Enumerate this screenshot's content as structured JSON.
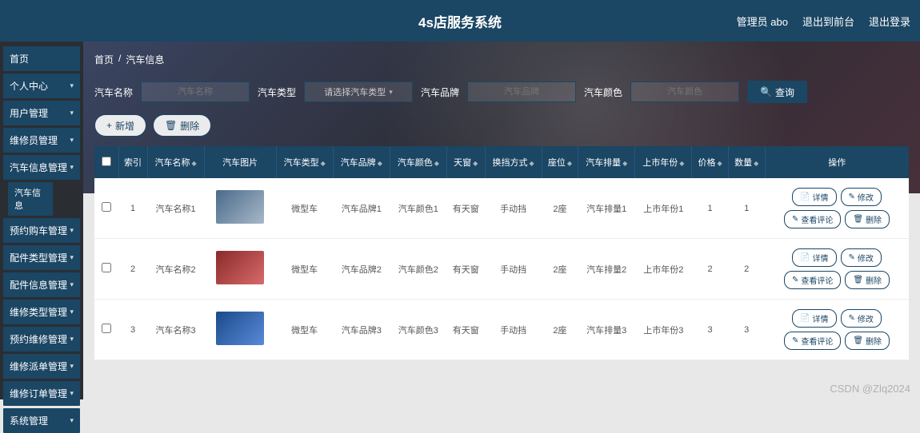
{
  "header": {
    "title": "4s店服务系统",
    "user": "管理员 abo",
    "logout_front": "退出到前台",
    "logout": "退出登录"
  },
  "sidebar": {
    "items": [
      {
        "label": "首页",
        "expand": false
      },
      {
        "label": "个人中心",
        "expand": true
      },
      {
        "label": "用户管理",
        "expand": true
      },
      {
        "label": "维修员管理",
        "expand": true
      },
      {
        "label": "汽车信息管理",
        "expand": true,
        "active": true,
        "sub": "汽车信息"
      },
      {
        "label": "预约购车管理",
        "expand": true
      },
      {
        "label": "配件类型管理",
        "expand": true
      },
      {
        "label": "配件信息管理",
        "expand": true
      },
      {
        "label": "维修类型管理",
        "expand": true
      },
      {
        "label": "预约维修管理",
        "expand": true
      },
      {
        "label": "维修派单管理",
        "expand": true
      },
      {
        "label": "维修订单管理",
        "expand": true
      },
      {
        "label": "系统管理",
        "expand": true
      }
    ]
  },
  "crumb": {
    "home": "首页",
    "sep": "/",
    "current": "汽车信息"
  },
  "filters": {
    "name_label": "汽车名称",
    "name_ph": "汽车名称",
    "type_label": "汽车类型",
    "type_ph": "请选择汽车类型",
    "brand_label": "汽车品牌",
    "brand_ph": "汽车品牌",
    "color_label": "汽车颜色",
    "color_ph": "汽车颜色",
    "query": "查询"
  },
  "toolbar": {
    "add": "新增",
    "del": "删除"
  },
  "columns": [
    "",
    "索引",
    "汽车名称",
    "汽车图片",
    "汽车类型",
    "汽车品牌",
    "汽车颜色",
    "天窗",
    "换挡方式",
    "座位",
    "汽车排量",
    "上市年份",
    "价格",
    "数量",
    "操作"
  ],
  "ops": {
    "detail": "详情",
    "edit": "修改",
    "review": "查看评论",
    "del": "删除"
  },
  "rows": [
    {
      "idx": "1",
      "name": "汽车名称1",
      "img": "",
      "type": "微型车",
      "brand": "汽车品牌1",
      "color": "汽车颜色1",
      "sun": "有天窗",
      "gear": "手动挡",
      "seat": "2座",
      "disp": "汽车排量1",
      "year": "上市年份1",
      "price": "1",
      "qty": "1"
    },
    {
      "idx": "2",
      "name": "汽车名称2",
      "img": "red",
      "type": "微型车",
      "brand": "汽车品牌2",
      "color": "汽车颜色2",
      "sun": "有天窗",
      "gear": "手动挡",
      "seat": "2座",
      "disp": "汽车排量2",
      "year": "上市年份2",
      "price": "2",
      "qty": "2"
    },
    {
      "idx": "3",
      "name": "汽车名称3",
      "img": "blue",
      "type": "微型车",
      "brand": "汽车品牌3",
      "color": "汽车颜色3",
      "sun": "有天窗",
      "gear": "手动挡",
      "seat": "2座",
      "disp": "汽车排量3",
      "year": "上市年份3",
      "price": "3",
      "qty": "3"
    }
  ],
  "watermark": "CSDN @Zlq2024"
}
